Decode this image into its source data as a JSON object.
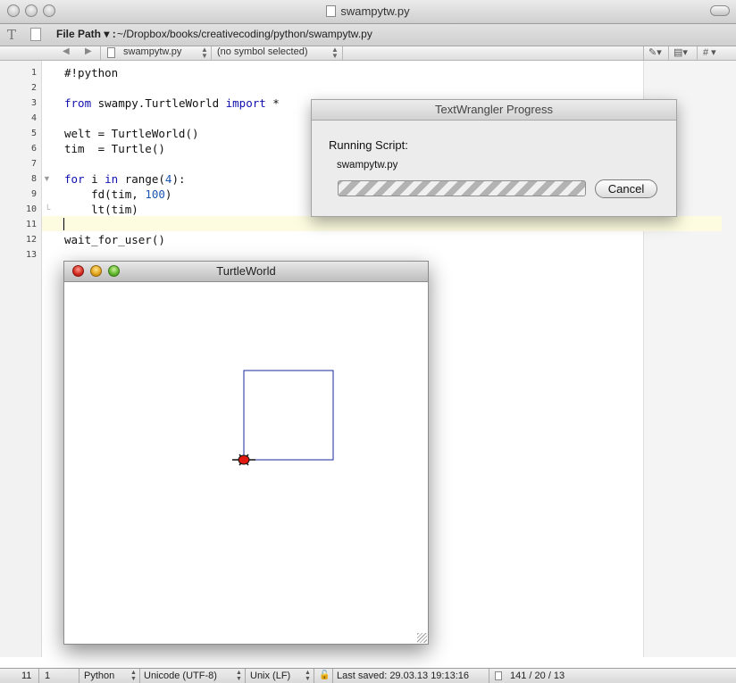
{
  "window": {
    "title": "swampytw.py"
  },
  "toolbar": {
    "file_path_label": "File Path ▾ :",
    "file_path": "~/Dropbox/books/creativecoding/python/swampytw.py"
  },
  "navbar": {
    "file": "swampytw.py",
    "symbol": "(no symbol selected)",
    "right_icons": [
      "pencil-icon",
      "document-icon",
      "hash-icon"
    ],
    "hash_label": "#"
  },
  "editor": {
    "line_numbers": [
      "1",
      "2",
      "3",
      "4",
      "5",
      "6",
      "7",
      "8",
      "9",
      "10",
      "11",
      "12",
      "13"
    ],
    "lines": {
      "l1": "#!python",
      "l3_kw1": "from",
      "l3_mid": " swampy.TurtleWorld ",
      "l3_kw2": "import",
      "l3_end": " *",
      "l5": "welt = TurtleWorld()",
      "l6": "tim  = Turtle()",
      "l8_kw1": "for",
      "l8_a": " i ",
      "l8_kw2": "in",
      "l8_b": " range(",
      "l8_num": "4",
      "l8_c": "):",
      "l9_a": "    fd(tim, ",
      "l9_num": "100",
      "l9_b": ")",
      "l10": "    lt(tim)",
      "l12": "wait_for_user()"
    }
  },
  "progress_dialog": {
    "title": "TextWrangler Progress",
    "running_label": "Running Script:",
    "script_name": "swampytw.py",
    "cancel_label": "Cancel",
    "progress": 1.0
  },
  "turtle_window": {
    "title": "TurtleWorld",
    "square_side": 100,
    "turns": 4,
    "pen_color": "#1a2aa0",
    "turtle_color": "#e01a10"
  },
  "statusbar": {
    "line": "11",
    "column": "1",
    "language": "Python",
    "encoding": "Unicode (UTF-8)",
    "line_endings": "Unix (LF)",
    "last_saved": "Last saved: 29.03.13 19:13:16",
    "counts": "141 / 20 / 13"
  }
}
